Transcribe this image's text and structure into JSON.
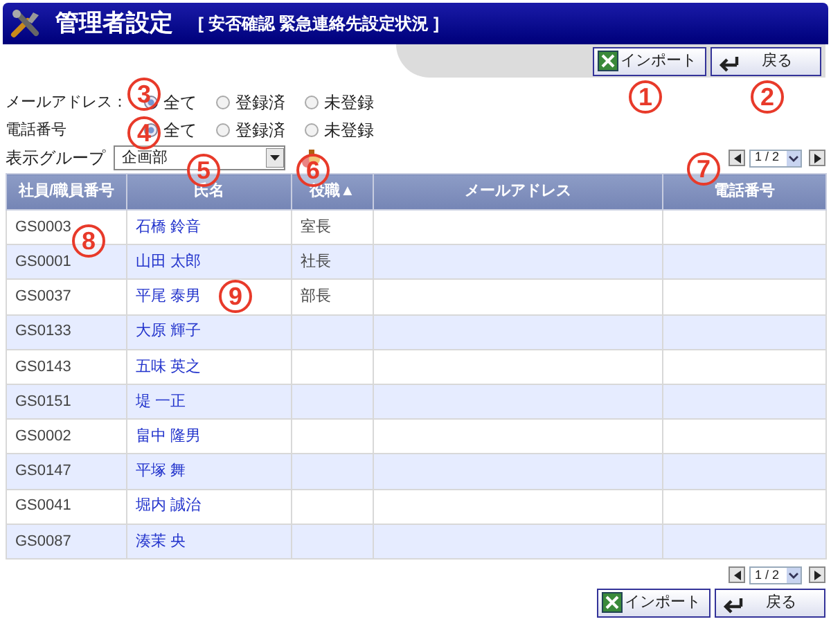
{
  "header": {
    "title": "管理者設定",
    "subtitle": "[ 安否確認 緊急連絡先設定状況 ]"
  },
  "top_buttons": [
    {
      "kind": "import",
      "label": "インポート"
    },
    {
      "kind": "back",
      "label": "戻る"
    }
  ],
  "filters": [
    {
      "label": "メールアドレス：",
      "options": [
        {
          "label": "全て",
          "selected": true
        },
        {
          "label": "登録済",
          "selected": false
        },
        {
          "label": "未登録",
          "selected": false
        }
      ]
    },
    {
      "label": "電話番号",
      "options": [
        {
          "label": "全て",
          "selected": true
        },
        {
          "label": "登録済",
          "selected": false
        },
        {
          "label": "未登録",
          "selected": false
        }
      ]
    }
  ],
  "group": {
    "label": "表示グループ",
    "value": "企画部"
  },
  "pager_top": {
    "value": "1 / 2"
  },
  "table": {
    "columns": [
      {
        "label": "社員/職員番号"
      },
      {
        "label": "氏名"
      },
      {
        "label": "役職▲"
      },
      {
        "label": "メールアドレス"
      },
      {
        "label": "電話番号"
      }
    ],
    "rows": [
      [
        "GS0003",
        "石橋 鈴音",
        "室長",
        "",
        ""
      ],
      [
        "GS0001",
        "山田 太郎",
        "社長",
        "",
        ""
      ],
      [
        "GS0037",
        "平尾 泰男",
        "部長",
        "",
        ""
      ],
      [
        "GS0133",
        "大原 輝子",
        "",
        "",
        ""
      ],
      [
        "GS0143",
        "五味 英之",
        "",
        "",
        ""
      ],
      [
        "GS0151",
        "堤 一正",
        "",
        "",
        ""
      ],
      [
        "GS0002",
        "畠中 隆男",
        "",
        "",
        ""
      ],
      [
        "GS0147",
        "平塚 舞",
        "",
        "",
        ""
      ],
      [
        "GS0041",
        "堀内 誠治",
        "",
        "",
        ""
      ],
      [
        "GS0087",
        "湊茉 央",
        "",
        "",
        ""
      ]
    ]
  },
  "pager_bottom": {
    "value": "1 / 2"
  },
  "bottom_buttons": [
    {
      "kind": "import",
      "label": "インポート"
    },
    {
      "kind": "back",
      "label": "戻る"
    }
  ],
  "annotations": [
    {
      "label": "3"
    },
    {
      "label": "1"
    },
    {
      "label": "2"
    },
    {
      "label": "4"
    },
    {
      "label": "5"
    },
    {
      "label": "6"
    },
    {
      "label": "7"
    },
    {
      "label": "8"
    },
    {
      "label": "9"
    }
  ]
}
